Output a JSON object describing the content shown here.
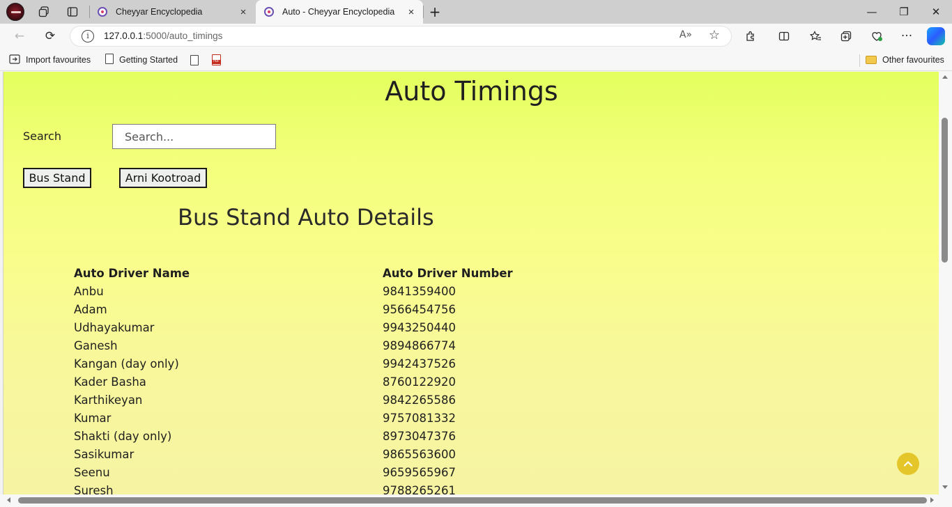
{
  "browser": {
    "tabs": [
      {
        "title": "Cheyyar Encyclopedia",
        "active": false
      },
      {
        "title": "Auto - Cheyyar Encyclopedia",
        "active": true
      }
    ],
    "address": {
      "host": "127.0.0.1",
      "path": ":5000/auto_timings"
    },
    "bookmarks": [
      {
        "label": "Import favourites"
      },
      {
        "label": "Getting Started"
      }
    ],
    "other_favourites": "Other favourites",
    "icons": {
      "close": "×",
      "new_tab": "+",
      "minimize": "—",
      "restore": "❐",
      "window_close": "✕",
      "back": "←",
      "refresh": "⟳",
      "more": "···",
      "read_aloud": "A»",
      "favorite": "☆"
    }
  },
  "page": {
    "title": "Auto Timings",
    "search": {
      "label": "Search",
      "placeholder": "Search..."
    },
    "locations": [
      "Bus Stand",
      "Arni Kootroad"
    ],
    "section_title": "Bus Stand Auto Details",
    "table": {
      "headers": [
        "Auto Driver Name",
        "Auto Driver Number"
      ],
      "rows": [
        [
          "Anbu",
          "9841359400"
        ],
        [
          "Adam",
          "9566454756"
        ],
        [
          "Udhayakumar",
          "9943250440"
        ],
        [
          "Ganesh",
          "9894866774"
        ],
        [
          "Kangan (day only)",
          "9942437526"
        ],
        [
          "Kader Basha",
          "8760122920"
        ],
        [
          "Karthikeyan",
          "9842265586"
        ],
        [
          "Kumar",
          "9757081332"
        ],
        [
          "Shakti (day only)",
          "8973047376"
        ],
        [
          "Sasikumar",
          "9865563600"
        ],
        [
          "Seenu",
          "9659565967"
        ],
        [
          "Suresh",
          "9788265261"
        ]
      ]
    },
    "colors": {
      "accent": "#e5c62a",
      "background_top": "#e3ff5e",
      "background_bottom": "#f6f4a3"
    }
  }
}
